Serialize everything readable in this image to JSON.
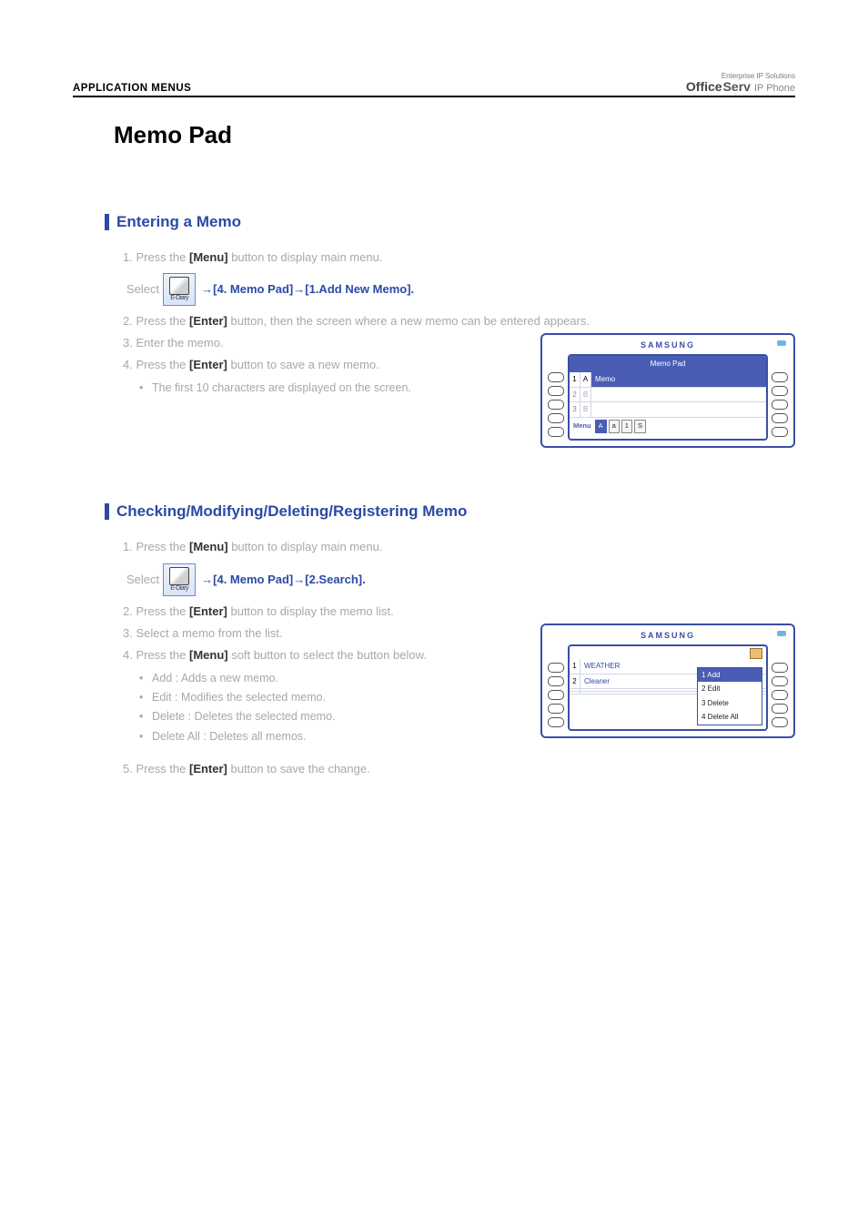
{
  "header": {
    "left": "APPLICATION MENUS",
    "right_top": "Enterprise IP Solutions",
    "right_office": "Office",
    "right_serv": "Serv",
    "right_ip": "IP Phone"
  },
  "title": "Memo Pad",
  "section1": {
    "heading": "Entering a Memo",
    "line1_a": "1.  Press the ",
    "line1_b": "[Menu]",
    "line1_c": " button to display main menu.",
    "nav_a": "Select ",
    "nav_icon_label": "E-Diary",
    "nav_arrow": "→",
    "nav_b": " [4. Memo Pad] ",
    "nav_c": " [1.Add New Memo].",
    "line2_a": "2.  Press the ",
    "line2_b": "[Enter]",
    "line2_c": " button, then the screen where a new memo can be entered appears.",
    "line3": "3.  Enter the memo.",
    "line4_a": "4.  Press the ",
    "line4_b": "[Enter]",
    "line4_c": " button to save a new memo.",
    "bullet": "The first 10 characters are displayed on the screen.",
    "device": {
      "brand": "SAMSUNG",
      "top_title": "Memo Pad",
      "row1_n": "1",
      "row1_l": "A",
      "row1_body": "Memo",
      "row2_n": "2",
      "row2_l": "B",
      "row3_n": "3",
      "row3_l": "B",
      "footer_label": "Menu",
      "footer_boxes": [
        "A",
        "a",
        "1",
        "S"
      ]
    }
  },
  "section2": {
    "heading": "Checking/Modifying/Deleting/Registering Memo",
    "line1_a": "1.  Press the ",
    "line1_b": "[Menu]",
    "line1_c": " button to display main menu.",
    "nav_a": "Select ",
    "nav_icon_label": "E-Diary",
    "nav_arrow": "→",
    "nav_b": " [4. Memo Pad] ",
    "nav_c": " [2.Search].",
    "line2_a": "2.  Press the ",
    "line2_b": "[Enter]",
    "line2_c": " button to display the memo list.",
    "line3": "3.  Select a memo from the list.",
    "line4_a": "4.  Press the ",
    "line4_b": "[Menu]",
    "line4_c": " soft button to select the button below.",
    "bullets": [
      "Add : Adds a new memo.",
      "Edit : Modifies the selected memo.",
      "Delete : Deletes the selected memo.",
      "Delete All : Deletes all memos."
    ],
    "line5_a": "5.  Press the ",
    "line5_b": "[Enter]",
    "line5_c": " button to save the change.",
    "device": {
      "brand": "SAMSUNG",
      "row1_n": "1",
      "row1_body": "WEATHER",
      "row2_n": "2",
      "row2_body": "Cleaner",
      "popup": [
        "1  Add",
        "2  Edit",
        "3  Delete",
        "4 Delete All"
      ]
    }
  }
}
